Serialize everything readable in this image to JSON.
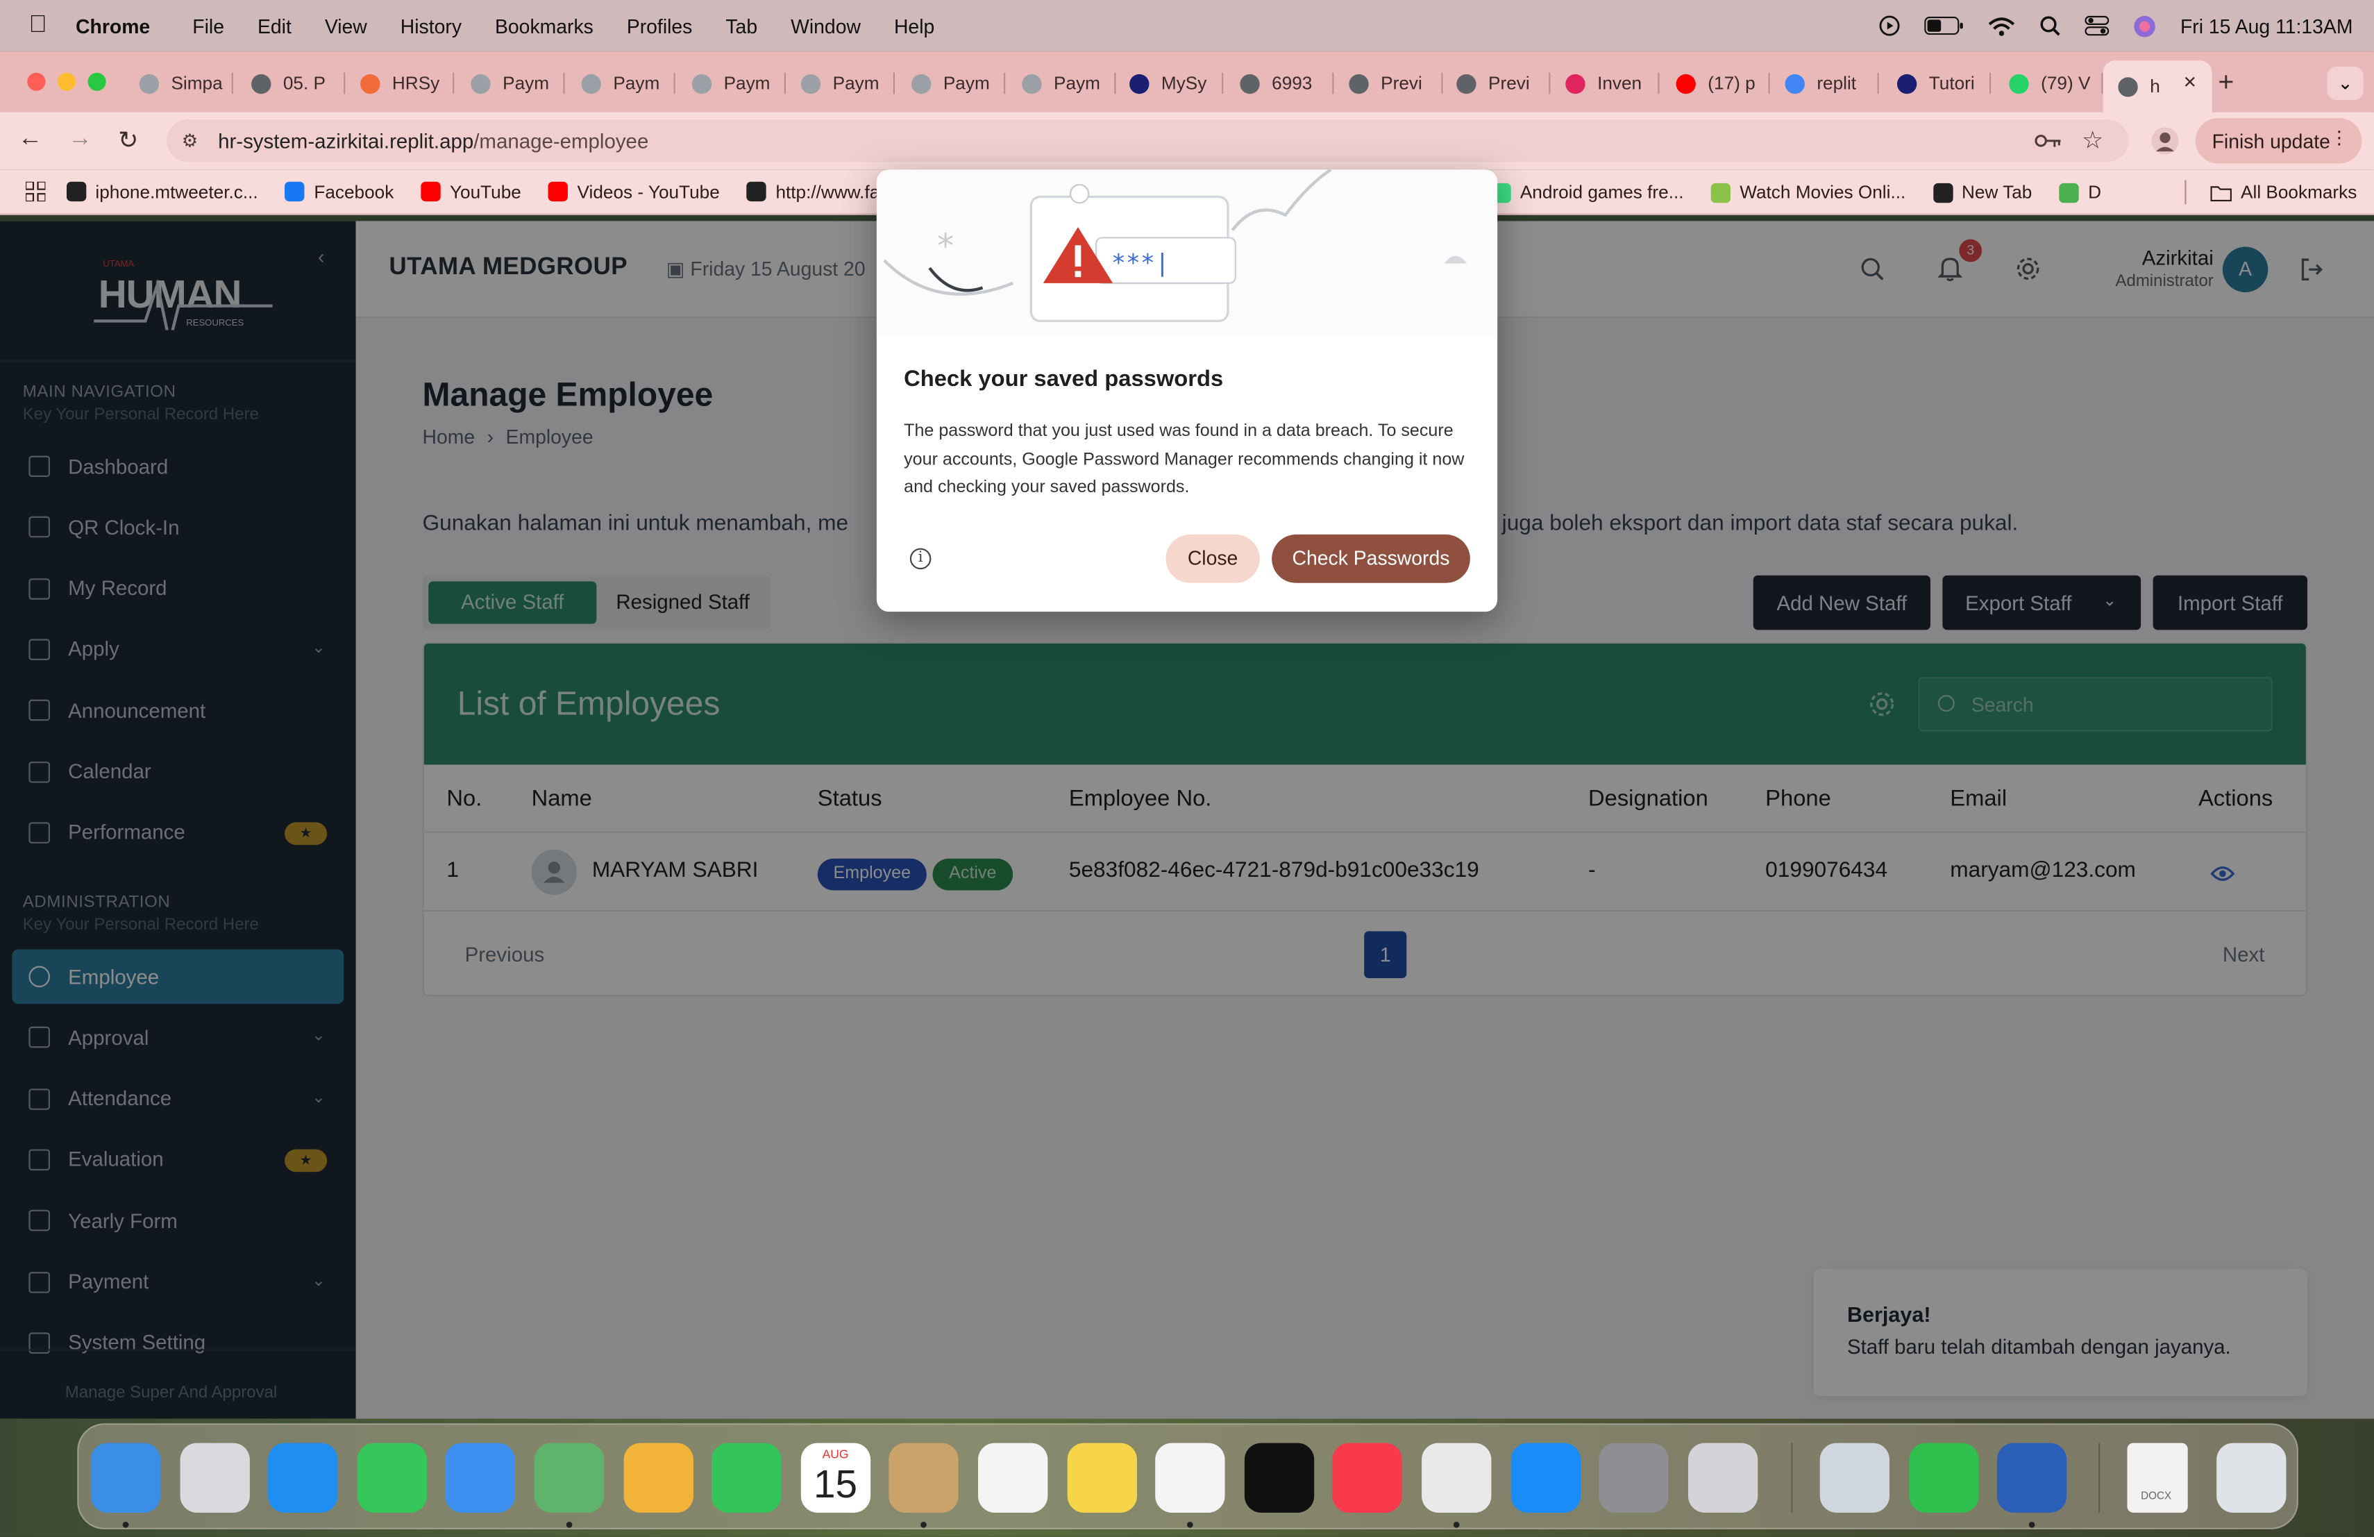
{
  "menubar": {
    "app": "Chrome",
    "items": [
      "File",
      "Edit",
      "View",
      "History",
      "Bookmarks",
      "Profiles",
      "Tab",
      "Window",
      "Help"
    ],
    "datetime": "Fri 15 Aug  11:13AM"
  },
  "tabs": [
    {
      "label": "Simpa",
      "color": "#9aa0a6"
    },
    {
      "label": "05. P",
      "color": "#5f6368"
    },
    {
      "label": "HRSy",
      "color": "#f26b3a"
    },
    {
      "label": "Paym",
      "color": "#9aa0a6"
    },
    {
      "label": "Paym",
      "color": "#9aa0a6"
    },
    {
      "label": "Paym",
      "color": "#9aa0a6"
    },
    {
      "label": "Paym",
      "color": "#9aa0a6"
    },
    {
      "label": "Paym",
      "color": "#9aa0a6"
    },
    {
      "label": "Paym",
      "color": "#9aa0a6"
    },
    {
      "label": "MySy",
      "color": "#1a1f71"
    },
    {
      "label": "6993",
      "color": "#5f6368"
    },
    {
      "label": "Previ",
      "color": "#5f6368"
    },
    {
      "label": "Previ",
      "color": "#5f6368"
    },
    {
      "label": "Inven",
      "color": "#e0245e"
    },
    {
      "label": "(17) p",
      "color": "#ff0000"
    },
    {
      "label": "replit",
      "color": "#4285f4"
    },
    {
      "label": "Tutori",
      "color": "#1a1f71"
    },
    {
      "label": "(79) V",
      "color": "#25d366"
    },
    {
      "label": "h",
      "color": "#5f6368"
    }
  ],
  "address": {
    "host": "hr-system-azirkitai.replit.app",
    "path": "/manage-employee",
    "finish_update": "Finish update"
  },
  "bookmarks": [
    {
      "label": "iphone.mtweeter.c...",
      "color": "#222"
    },
    {
      "label": "Facebook",
      "color": "#1877f2"
    },
    {
      "label": "YouTube",
      "color": "#ff0000"
    },
    {
      "label": "Videos - YouTube",
      "color": "#ff0000"
    },
    {
      "label": "http://www.fa",
      "color": "#222"
    }
  ],
  "bookmarks_right": [
    {
      "label": "Android games fre...",
      "color": "#3ddc84"
    },
    {
      "label": "Watch Movies Onli...",
      "color": "#8bc34a"
    },
    {
      "label": "New Tab",
      "color": "#222"
    },
    {
      "label": "D",
      "color": "#4caf50"
    }
  ],
  "all_bookmarks": "All Bookmarks",
  "sidebar": {
    "logo_small": "UTAMA",
    "logo_main": "HUMAN",
    "logo_sub": "RESOURCES",
    "main_title": "MAIN NAVIGATION",
    "main_sub": "Key Your Personal Record Here",
    "main_items": [
      {
        "label": "Dashboard"
      },
      {
        "label": "QR Clock-In"
      },
      {
        "label": "My Record"
      },
      {
        "label": "Apply",
        "chevron": true
      },
      {
        "label": "Announcement"
      },
      {
        "label": "Calendar"
      },
      {
        "label": "Performance",
        "star": true
      }
    ],
    "admin_title": "ADMINISTRATION",
    "admin_sub": "Key Your Personal Record Here",
    "admin_items": [
      {
        "label": "Employee",
        "active": true
      },
      {
        "label": "Approval",
        "chevron": true
      },
      {
        "label": "Attendance",
        "chevron": true
      },
      {
        "label": "Evaluation",
        "star": true
      },
      {
        "label": "Yearly Form"
      },
      {
        "label": "Payment",
        "chevron": true
      },
      {
        "label": "System Setting"
      }
    ],
    "footer": "Manage Super And Approval",
    "star_glyph": "★"
  },
  "topbar": {
    "brand": "UTAMA MEDGROUP",
    "date": "Friday 15 August 20",
    "notification_count": "3",
    "user_name": "Azirkitai",
    "user_role": "Administrator",
    "avatar_letter": "A"
  },
  "page": {
    "title": "Manage Employee",
    "crumb_home": "Home",
    "crumb_current": "Employee",
    "intro_left": "Gunakan halaman ini untuk menambah, me",
    "intro_right": "juga boleh eksport dan import data staf secara pukal.",
    "tab_active": "Active Staff",
    "tab_resigned": "Resigned Staff",
    "btn_add": "Add New Staff",
    "btn_export": "Export Staff",
    "btn_import": "Import Staff"
  },
  "table": {
    "title": "List of Employees",
    "search_placeholder": "Search",
    "headers": [
      "No.",
      "Name",
      "Status",
      "Employee No.",
      "Designation",
      "Phone",
      "Email",
      "Actions"
    ],
    "rows": [
      {
        "no": "1",
        "name": "MARYAM SABRI",
        "type_badge": "Employee",
        "status_badge": "Active",
        "employee_no": "5e83f082-46ec-4721-879d-b91c00e33c19",
        "designation": "-",
        "phone": "0199076434",
        "email": "maryam@123.com"
      }
    ],
    "prev": "Previous",
    "page": "1",
    "next": "Next"
  },
  "toast": {
    "title": "Berjaya!",
    "message": "Staff baru telah ditambah dengan jayanya."
  },
  "dialog": {
    "title": "Check your saved passwords",
    "body": "The password that you just used was found in a data breach. To secure your accounts, Google Password Manager recommends changing it now and checking your saved passwords.",
    "close": "Close",
    "check": "Check Passwords",
    "art_text": "***|"
  },
  "dock": {
    "calendar_month": "AUG",
    "calendar_day": "15",
    "docx_label": "DOCX",
    "apps": [
      {
        "name": "finder-icon",
        "color": "#3a8ee6",
        "dot": true
      },
      {
        "name": "launchpad-icon",
        "color": "#d9d9de",
        "dot": false
      },
      {
        "name": "safari-icon",
        "color": "#1e8ef2",
        "dot": false
      },
      {
        "name": "messages-icon",
        "color": "#35c759",
        "dot": false
      },
      {
        "name": "mail-icon",
        "color": "#3d8ff0",
        "dot": false
      },
      {
        "name": "maps-icon",
        "color": "#5fb36b",
        "dot": true
      },
      {
        "name": "photos-icon",
        "color": "#f2b33b",
        "dot": false
      },
      {
        "name": "facetime-icon",
        "color": "#33c55a",
        "dot": false
      },
      {
        "name": "calendar-icon",
        "color": "#ffffff",
        "dot": false
      },
      {
        "name": "contacts-icon",
        "color": "#c9a36a",
        "dot": true
      },
      {
        "name": "reminders-icon",
        "color": "#f4f4f4",
        "dot": false
      },
      {
        "name": "notes-icon",
        "color": "#f7d54a",
        "dot": false
      },
      {
        "name": "freeform-icon",
        "color": "#f4f4f4",
        "dot": true
      },
      {
        "name": "apple-tv-icon",
        "color": "#111111",
        "dot": false
      },
      {
        "name": "music-icon",
        "color": "#f83a4c",
        "dot": false
      },
      {
        "name": "chrome-icon",
        "color": "#e9e9e9",
        "dot": true
      },
      {
        "name": "app-store-icon",
        "color": "#1a8cf7",
        "dot": false
      },
      {
        "name": "system-settings-icon",
        "color": "#8e8e93",
        "dot": false
      },
      {
        "name": "iphone-mirroring-icon",
        "color": "#d4d4d8",
        "dot": false
      }
    ],
    "apps_right": [
      {
        "name": "preview-icon",
        "color": "#cfd6dd",
        "dot": false
      },
      {
        "name": "numbers-icon",
        "color": "#2fbf4d",
        "dot": false
      },
      {
        "name": "word-icon",
        "color": "#2b5fb8",
        "dot": true
      }
    ]
  }
}
